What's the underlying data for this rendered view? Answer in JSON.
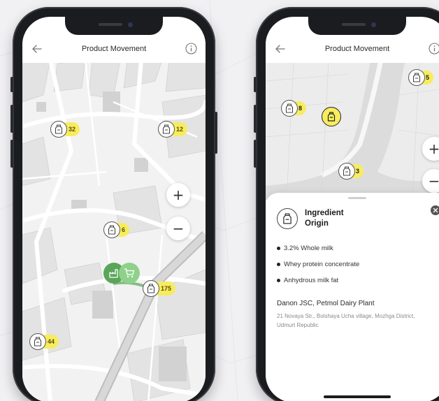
{
  "colors": {
    "badge_yellow": "#f7ec5f",
    "accent_green": "#5aa55a",
    "light_green": "#8fd18a",
    "map_block": "#dcdcdc",
    "water": "#e2e2e2"
  },
  "phone_left": {
    "title": "Product Movement",
    "icons": {
      "back": "arrow-left-icon",
      "info": "info-icon",
      "zoom_in": "plus-icon",
      "zoom_out": "minus-icon"
    },
    "zoom_in_label": "+",
    "zoom_out_label": "−",
    "markers": [
      {
        "icon": "milk-bottle-icon",
        "count": "32"
      },
      {
        "icon": "milk-bottle-icon",
        "count": "12"
      },
      {
        "icon": "milk-bottle-icon",
        "count": "6"
      },
      {
        "icon": "milk-bottle-icon",
        "count": "175"
      },
      {
        "icon": "milk-bottle-icon",
        "count": "44"
      }
    ],
    "route_icons": [
      "factory-icon",
      "shopping-cart-icon"
    ]
  },
  "phone_right": {
    "title": "Product Movement",
    "icons": {
      "back": "arrow-left-icon",
      "info": "info-icon",
      "close": "close-icon"
    },
    "zoom_in_label": "+",
    "zoom_out_label": "−",
    "markers": [
      {
        "icon": "milk-bottle-icon",
        "count": "5"
      },
      {
        "icon": "milk-bottle-icon",
        "count": "8"
      },
      {
        "icon": "milk-bottle-icon",
        "count": ""
      },
      {
        "icon": "milk-bottle-icon",
        "count": "3"
      }
    ],
    "sheet": {
      "title": "Ingredient Origin",
      "ingredients": [
        "3.2% Whole milk",
        "Whey protein concentrate",
        "Anhydrous milk fat"
      ],
      "company": "Danon JSC, Petmol Dairy Plant",
      "address": "21 Novaya Str., Bolshaya Ucha village, Mozhga District, Udmurt Republic"
    }
  }
}
